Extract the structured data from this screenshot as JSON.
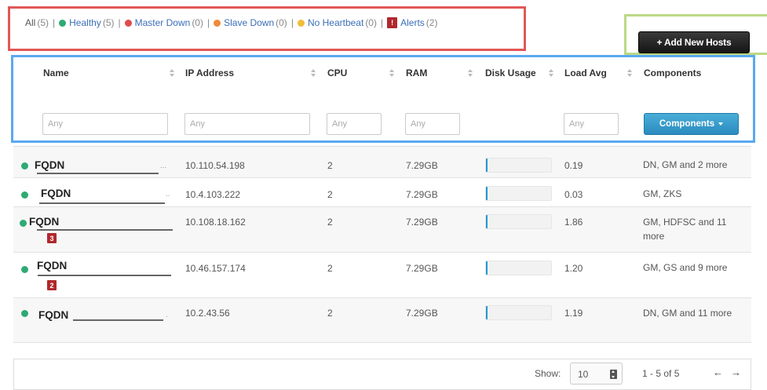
{
  "filters": {
    "all_label": "All",
    "all_count": "(5)",
    "items": [
      {
        "label": "Healthy",
        "count": "(5)",
        "color": "#2eaa73"
      },
      {
        "label": "Master Down",
        "count": "(0)",
        "color": "#e04b4b"
      },
      {
        "label": "Slave Down",
        "count": "(0)",
        "color": "#ef8a3a"
      },
      {
        "label": "No Heartbeat",
        "count": "(0)",
        "color": "#f1bd3c"
      }
    ],
    "alerts": {
      "label": "Alerts",
      "count": "(2)",
      "badge": "!",
      "color": "#b0282d"
    }
  },
  "toolbar": {
    "add_hosts_label": "+ Add New Hosts"
  },
  "columns": {
    "name": "Name",
    "ip": "IP Address",
    "cpu": "CPU",
    "ram": "RAM",
    "disk": "Disk Usage",
    "load": "Load Avg",
    "components": "Components"
  },
  "column_filters": {
    "name_placeholder": "Any",
    "ip_placeholder": "Any",
    "cpu_placeholder": "Any",
    "ram_placeholder": "Any",
    "load_placeholder": "Any",
    "components_button": "Components"
  },
  "rows": [
    {
      "name": "FQDN",
      "ip": "10.110.54.198",
      "cpu": "2",
      "ram": "7.29GB",
      "disk_used": 0.03,
      "load": "0.19",
      "components": "DN, GM and 2 more",
      "alerts": ""
    },
    {
      "name": "FQDN",
      "ip": "10.4.103.222",
      "cpu": "2",
      "ram": "7.29GB",
      "disk_used": 0.03,
      "load": "0.03",
      "components": "GM, ZKS",
      "alerts": ""
    },
    {
      "name": "FQDN",
      "ip": "10.108.18.162",
      "cpu": "2",
      "ram": "7.29GB",
      "disk_used": 0.03,
      "load": "1.86",
      "components": "GM, HDFSC and 11 more",
      "alerts": "3"
    },
    {
      "name": "FQDN",
      "ip": "10.46.157.174",
      "cpu": "2",
      "ram": "7.29GB",
      "disk_used": 0.03,
      "load": "1.20",
      "components": "GM, GS and 9 more",
      "alerts": "2"
    },
    {
      "name": "FQDN",
      "ip": "10.2.43.56",
      "cpu": "2",
      "ram": "7.29GB",
      "disk_used": 0.03,
      "load": "1.19",
      "components": "DN, GM and 11 more",
      "alerts": ""
    }
  ],
  "pagination": {
    "show_label": "Show:",
    "page_size": "10",
    "range": "1 - 5 of 5",
    "prev": "←",
    "next": "→"
  }
}
